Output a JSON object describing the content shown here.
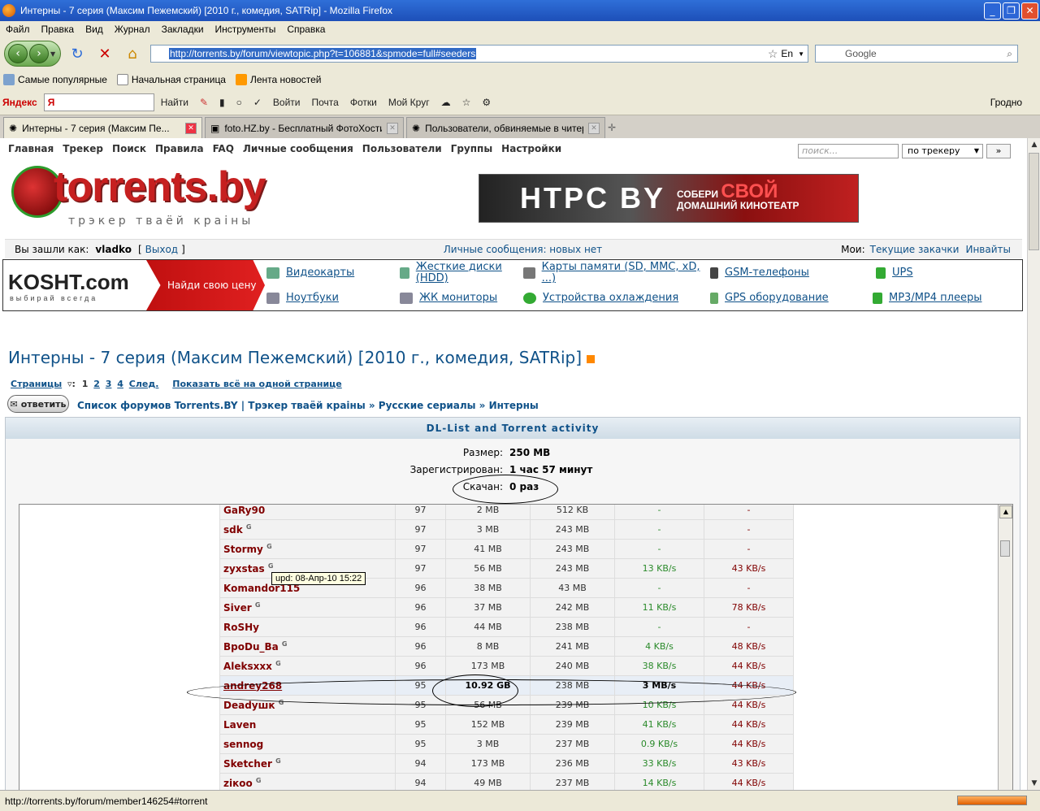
{
  "window": {
    "title": "Интерны - 7 серия (Максим Пежемский) [2010 г., комедия, SATRip] - Mozilla Firefox"
  },
  "menu": [
    "Файл",
    "Правка",
    "Вид",
    "Журнал",
    "Закладки",
    "Инструменты",
    "Справка"
  ],
  "nav": {
    "url": "http://torrents.by/forum/viewtopic.php?t=106881&spmode=full#seeders",
    "lang": "En",
    "search_placeholder": "Google"
  },
  "bookmarks": [
    "Самые популярные",
    "Начальная страница",
    "Лента новостей"
  ],
  "yandex": {
    "brand": "Яндекс",
    "input": "Я",
    "find": "Найти",
    "login": "Войти",
    "mail": "Почта",
    "photos": "Фотки",
    "circle": "Мой Круг",
    "city": "Гродно"
  },
  "tabs": [
    {
      "label": "Интерны - 7 серия (Максим Пе..."
    },
    {
      "label": "foto.HZ.by - Бесплатный ФотоХостинг"
    },
    {
      "label": "Пользователи, обвиняемые в читерс..."
    }
  ],
  "site": {
    "topnav": [
      "Главная",
      "Трекер",
      "Поиск",
      "Правила",
      "FAQ",
      "Личные сообщения",
      "Пользователи",
      "Группы",
      "Настройки"
    ],
    "search_placeholder": "поиск...",
    "search_scope": "по трекеру",
    "search_go": "»",
    "logo": "torrents.by",
    "logo_sub": "трэкер тваёй краіны",
    "banner": {
      "brand": "HTPC BY",
      "line1": "СОБЕРИ",
      "big": "СВОЙ",
      "line2": "ДОМАШНИЙ КИНОТЕАТР"
    },
    "login_prefix": "Вы зашли как:",
    "user": "vladko",
    "logout": "Выход",
    "pm": "Личные сообщения: новых нет",
    "my_prefix": "Мои:",
    "my_dl": "Текущие закачки",
    "my_inv": "Инвайты"
  },
  "ad": {
    "brand": "KOSHT.com",
    "slogan": "выбирай всегда",
    "cta": "Найди свою цену",
    "links": [
      "Видеокарты",
      "Жесткие диски (HDD)",
      "Карты памяти (SD, MMC, xD, ...)",
      "GSM-телефоны",
      "UPS",
      "Ноутбуки",
      "ЖК мониторы",
      "Устройства охлаждения",
      "GPS оборудование",
      "MP3/MP4 плееры"
    ]
  },
  "topic": {
    "title": "Интерны - 7 серия (Максим Пежемский) [2010 г., комедия, SATRip]",
    "pages_label": "Страницы",
    "pages": [
      "1",
      "2",
      "3",
      "4"
    ],
    "next": "След.",
    "show_all": "Показать всё на одной странице",
    "reply": "ответить",
    "crumbs": "Список форумов Torrents.BY | Трэкер тваёй краіны » Русские сериалы » Интерны"
  },
  "dl": {
    "header": "DL-List and Torrent activity",
    "size_label": "Размер:",
    "size": "250 MB",
    "reg_label": "Зарегистрирован:",
    "reg": "1 час 57 минут",
    "done_label": "Скачан:",
    "done": "0 раз"
  },
  "seeders": [
    {
      "name": "GaRy90",
      "g": "",
      "c": "97",
      "d": "2 MB",
      "u": "512 KB",
      "s1": "-",
      "s2": "-"
    },
    {
      "name": "sdk",
      "g": "G",
      "c": "97",
      "d": "3 MB",
      "u": "243 MB",
      "s1": "-",
      "s2": "-"
    },
    {
      "name": "Stormy",
      "g": "G",
      "c": "97",
      "d": "41 MB",
      "u": "243 MB",
      "s1": "-",
      "s2": "-"
    },
    {
      "name": "zyxstas",
      "g": "G",
      "c": "97",
      "d": "56 MB",
      "u": "243 MB",
      "s1": "13 KB/s",
      "s2": "43 KB/s"
    },
    {
      "name": "Komandor115",
      "g": "",
      "c": "96",
      "d": "38 MB",
      "u": "43 MB",
      "s1": "-",
      "s2": "-"
    },
    {
      "name": "Siver",
      "g": "G",
      "c": "96",
      "d": "37 MB",
      "u": "242 MB",
      "s1": "11 KB/s",
      "s2": "78 KB/s"
    },
    {
      "name": "RoSHy",
      "g": "",
      "c": "96",
      "d": "44 MB",
      "u": "238 MB",
      "s1": "-",
      "s2": "-"
    },
    {
      "name": "BpoDu_Ba",
      "g": "G",
      "c": "96",
      "d": "8 MB",
      "u": "241 MB",
      "s1": "4 KB/s",
      "s2": "48 KB/s"
    },
    {
      "name": "Aleksxxx",
      "g": "G",
      "c": "96",
      "d": "173 MB",
      "u": "240 MB",
      "s1": "38 KB/s",
      "s2": "44 KB/s"
    },
    {
      "name": "andrey268",
      "g": "",
      "c": "95",
      "d": "10.92 GB",
      "u": "238 MB",
      "s1": "3 MB/s",
      "s2": "44 KB/s"
    },
    {
      "name": "Deadyшк",
      "g": "G",
      "c": "95",
      "d": "56 MB",
      "u": "239 MB",
      "s1": "10 KB/s",
      "s2": "44 KB/s"
    },
    {
      "name": "Laven",
      "g": "",
      "c": "95",
      "d": "152 MB",
      "u": "239 MB",
      "s1": "41 KB/s",
      "s2": "44 KB/s"
    },
    {
      "name": "sennog",
      "g": "",
      "c": "95",
      "d": "3 MB",
      "u": "237 MB",
      "s1": "0.9 KB/s",
      "s2": "44 KB/s"
    },
    {
      "name": "Sketcher",
      "g": "G",
      "c": "94",
      "d": "173 MB",
      "u": "236 MB",
      "s1": "33 KB/s",
      "s2": "43 KB/s"
    },
    {
      "name": "ziкoo",
      "g": "G",
      "c": "94",
      "d": "49 MB",
      "u": "237 MB",
      "s1": "14 KB/s",
      "s2": "44 KB/s"
    }
  ],
  "tooltip": "upd: 08-Апр-10 15:22",
  "status": "http://torrents.by/forum/member146254#torrent"
}
